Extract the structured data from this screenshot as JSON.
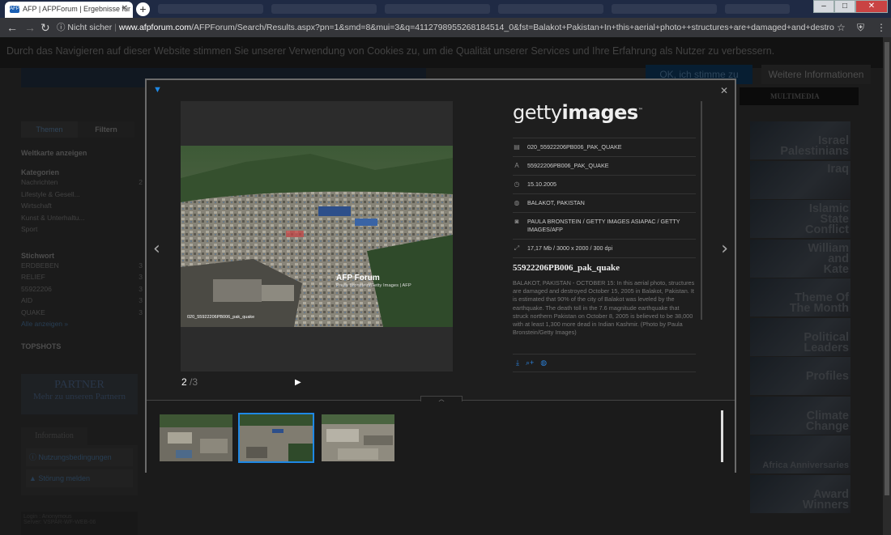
{
  "browser": {
    "tab_title": "AFP | AFPForum | Ergebnisse für ...",
    "tab_favicon": "AFP",
    "new_tab_symbol": "+",
    "security_label": "Nicht sicher",
    "url_host": "www.afpforum.com",
    "url_path": "/AFPForum/Search/Results.aspx?pn=1&smd=8&mui=3&q=4112798955268184514_0&fst=Balakot+Pakistan+In+this+aerial+photo++structures+are+damaged+and+destroyed+&fto=3&t=2&c..."
  },
  "cookie_banner": {
    "text": "Durch das Navigieren auf dieser Website stimmen Sie unserer Verwendung von Cookies zu, um die Qualität unserer Services und Ihre Erfahrung als Nutzer zu verbessern.",
    "ok_label": "OK, ich stimme zu",
    "more_label": "Weitere Informationen"
  },
  "header": {
    "multimedia_label": "MULTIMEDIA"
  },
  "sidebar": {
    "tab_themes": "Themen",
    "tab_filter": "Filtern",
    "world_map": "Weltkarte anzeigen",
    "categories_title": "Kategorien",
    "categories": [
      {
        "label": "Nachrichten",
        "count": "2"
      },
      {
        "label": "Lifestyle & Gesell...",
        "count": ""
      },
      {
        "label": "Wirtschaft",
        "count": ""
      },
      {
        "label": "Kunst & Unterhaltu...",
        "count": ""
      },
      {
        "label": "Sport",
        "count": ""
      }
    ],
    "keywords_title": "Stichwort",
    "keywords": [
      {
        "label": "ERDBEBEN",
        "count": "3"
      },
      {
        "label": "RELIEF",
        "count": "3"
      },
      {
        "label": "55922206",
        "count": "3"
      },
      {
        "label": "AID",
        "count": "3"
      },
      {
        "label": "QUAKE",
        "count": "3"
      }
    ],
    "show_all": "Alle anzeigen »",
    "topshots": "TOPSHOTS",
    "partner_line1": "PARTNER",
    "partner_line2": "Mehr zu unseren Partnern",
    "info_tab": "Information",
    "info_links": [
      "Nutzungsbedingungen",
      "Störung melden"
    ],
    "login_line1": "Login : Anonymous",
    "login_line2": "Server: VSPAR-WF-WEB-06"
  },
  "themes": [
    {
      "label": "Israel Palestinians"
    },
    {
      "label": "Iraq"
    },
    {
      "label": "Islamic State Conflict"
    },
    {
      "label": "William and Kate"
    },
    {
      "label": "Theme Of The Month"
    },
    {
      "label": "Political Leaders"
    },
    {
      "label": "Profiles"
    },
    {
      "label": "Climate Change"
    },
    {
      "label": "Africa Anniversaries"
    },
    {
      "label": "Award Winners"
    }
  ],
  "lightbox": {
    "counter_current": "2",
    "counter_total": "/3",
    "photo_overlay_title": "AFP Forum",
    "photo_overlay_credit": "Paula Bronstein/Getty Images | AFP",
    "photo_overlay_filename": "020_55922206PB006_pak_quake",
    "brand_light": "getty",
    "brand_bold": "images",
    "meta": [
      {
        "icon": "document-icon",
        "glyph": "▤",
        "value": "020_55922206PB006_PAK_QUAKE"
      },
      {
        "icon": "letter-a-icon",
        "glyph": "A",
        "value": "55922206PB006_PAK_QUAKE"
      },
      {
        "icon": "clock-icon",
        "glyph": "◷",
        "value": "15.10.2005"
      },
      {
        "icon": "globe-icon",
        "glyph": "◍",
        "value": "BALAKOT, PAKISTAN"
      },
      {
        "icon": "camera-icon",
        "glyph": "◙",
        "value": "PAULA BRONSTEIN / GETTY IMAGES ASIAPAC / GETTY IMAGES/AFP"
      },
      {
        "icon": "resize-icon",
        "glyph": "⤢",
        "value": "17,17 Mb / 3000 x 2000 / 300 dpi"
      }
    ],
    "title": "55922206PB006_pak_quake",
    "description": "BALAKOT, PAKISTAN - OCTOBER 15: In this aerial photo, structures are damaged and destroyed October 15, 2005 in Balakot, Pakistan. It is estimated that 90% of the city of Balakot was leveled by the earthquake. The death toll in the 7.6 magnitude earthquake that struck northern Pakistan on October 8, 2005 is believed to be 38,000 with at least 1,300 more dead in Indian Kashmir. (Photo by Paula Bronstein/Getty Images)"
  }
}
